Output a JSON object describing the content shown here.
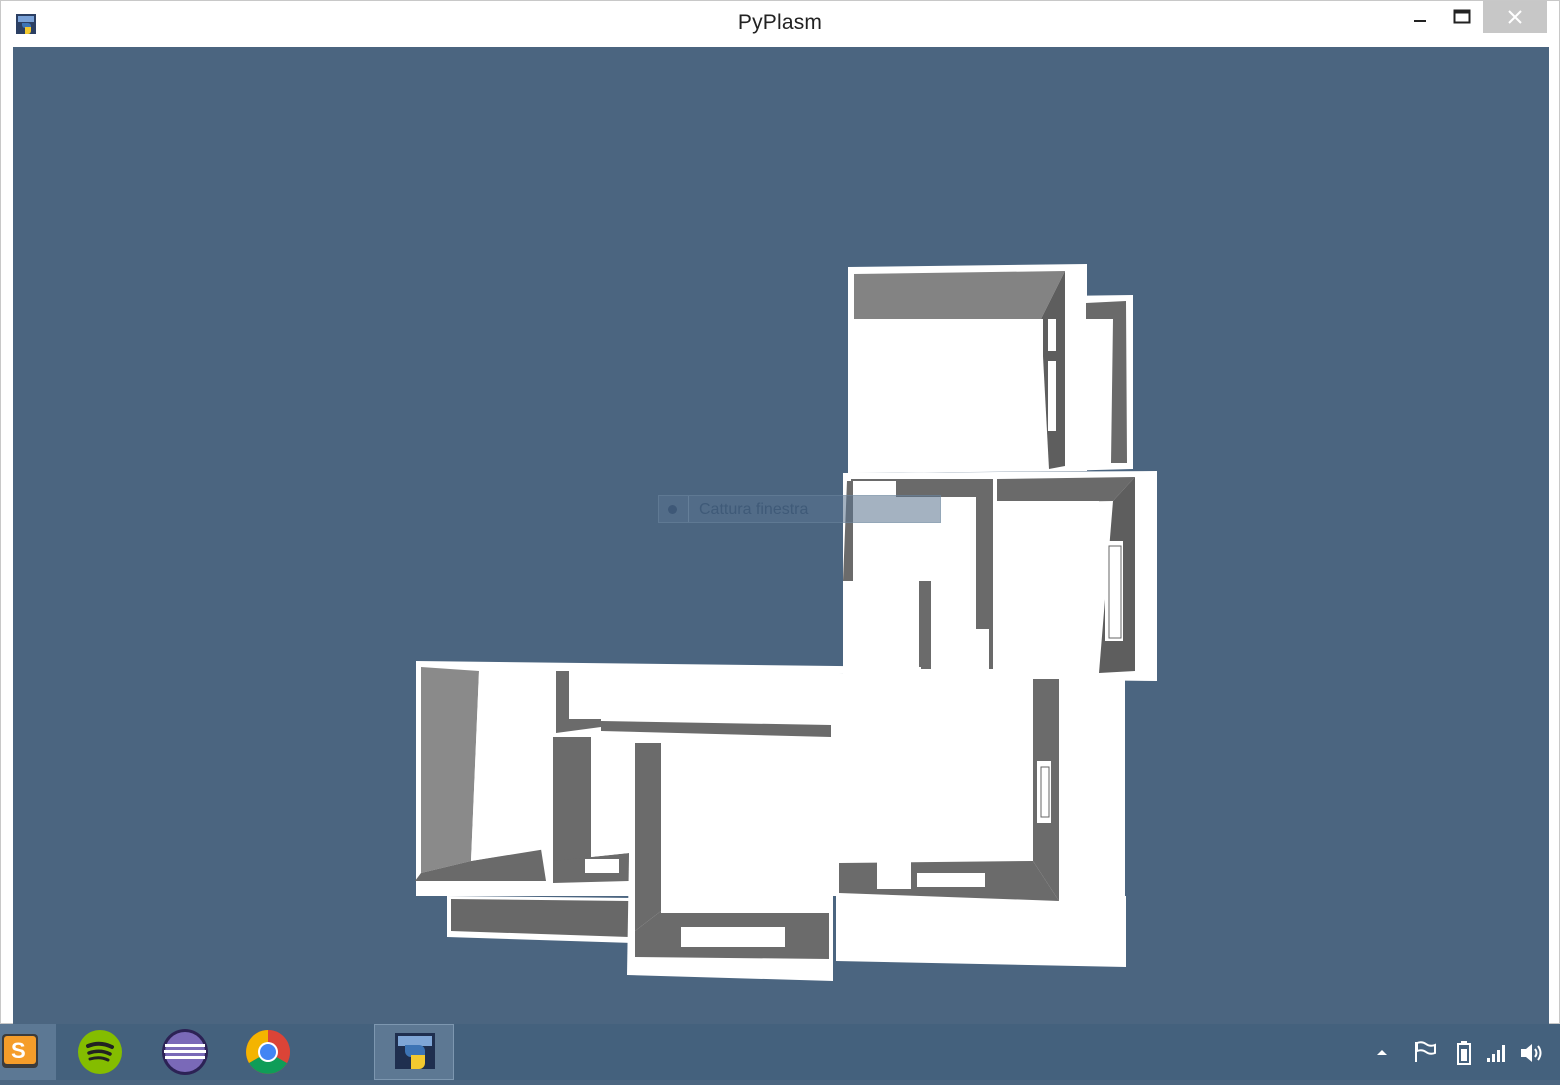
{
  "window": {
    "title": "PyPlasm",
    "app_icon": "pyplasm-icon",
    "controls": {
      "minimize": "minimize-icon",
      "maximize": "maximize-icon",
      "close": "close-icon"
    }
  },
  "viewport": {
    "background": "#4b6580",
    "tooltip_text": "Cattura finestra",
    "model": "3d-floor-plan"
  },
  "taskbar": {
    "apps": [
      {
        "name": "sublime-text",
        "icon": "sublime-text-icon"
      },
      {
        "name": "spotify",
        "icon": "spotify-icon"
      },
      {
        "name": "eclipse",
        "icon": "eclipse-icon"
      },
      {
        "name": "chrome",
        "icon": "chrome-icon"
      },
      {
        "name": "pyplasm",
        "icon": "pyplasm-icon",
        "active": true
      }
    ],
    "tray": [
      "show-hidden-icons-icon",
      "action-center-flag-icon",
      "battery-icon",
      "network-signal-icon",
      "volume-icon"
    ]
  }
}
